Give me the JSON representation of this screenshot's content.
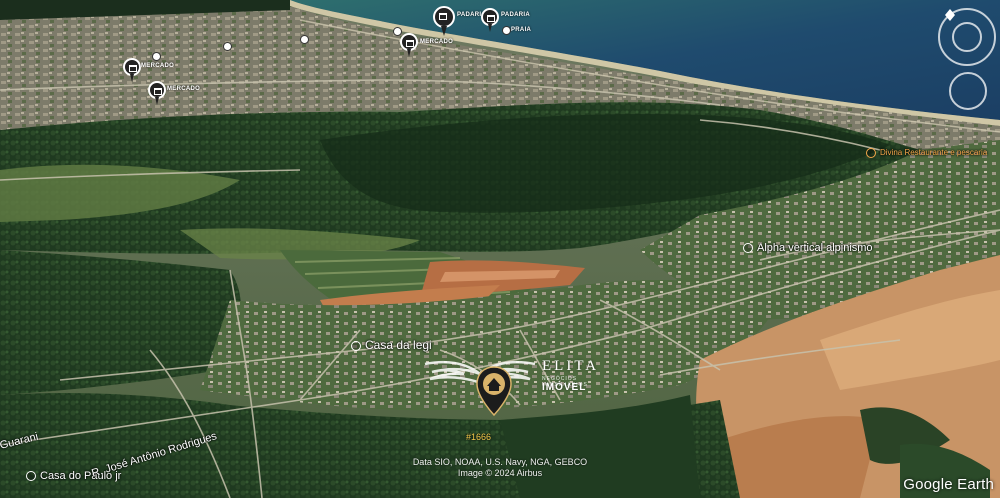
{
  "map": {
    "attribution_lines": [
      "Data SIO, NOAA, U.S. Navy, NGA, GEBCO",
      "Image © 2024 Airbus"
    ],
    "provider_logo": "Google Earth",
    "colors": {
      "ocean": "#1f4b6e",
      "ocean_shallow": "#2e6f6e",
      "forest": "#223d22",
      "pasture": "#5f7a43",
      "urban": "#8b8877",
      "exposed_soil": "#c37d4d",
      "pin_dark": "#222222",
      "lot_label": "#f3c64a"
    }
  },
  "places": {
    "casa_da_legi": "Casa da legi",
    "alpha_vertical": "Alpha vertical alpinismo",
    "divina": "Divina Restaurante e pescaria",
    "casa_do_paulo": "Casa do Paulo jr"
  },
  "streets": {
    "r_jose_antonio": "R. José Antônio Rodrigues",
    "guarani": "Guarani"
  },
  "pins": {
    "padaria_1": "PADARIA",
    "padaria_2": "PADARIA",
    "mercado_1": "MERCADO",
    "mercado_2": "MERCADO",
    "mercado_3": "MERCADO",
    "praia": "PRAIA"
  },
  "brand": {
    "name": "ELITA",
    "tagline": "NEGÓCIOS IMOBILIÁRIOS",
    "subname": "IMÓVEL",
    "lot_label": "#1666"
  },
  "controls": {
    "compass_icon": "compass-icon",
    "zoom_icon": "zoom-icon"
  }
}
